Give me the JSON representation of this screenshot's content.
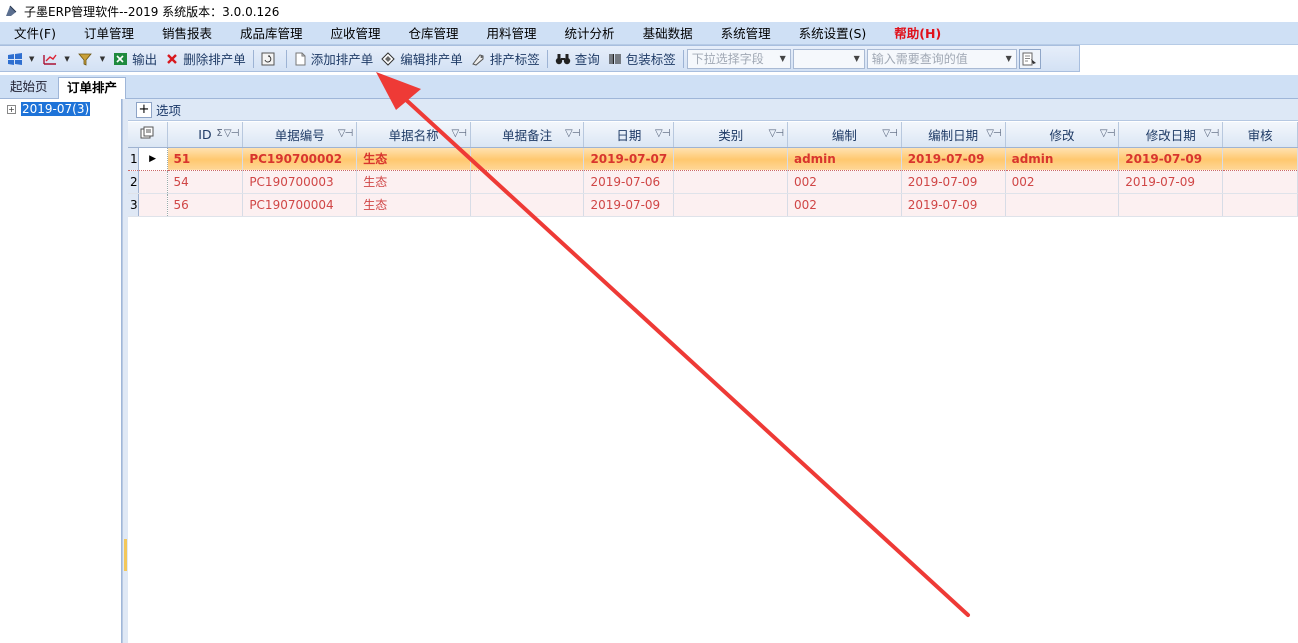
{
  "window": {
    "title": "子墨ERP管理软件--2019 系统版本：3.0.0.126"
  },
  "menu": [
    {
      "label": "文件(F)"
    },
    {
      "label": "订单管理"
    },
    {
      "label": "销售报表"
    },
    {
      "label": "成品库管理"
    },
    {
      "label": "应收管理"
    },
    {
      "label": "仓库管理"
    },
    {
      "label": "用料管理"
    },
    {
      "label": "统计分析"
    },
    {
      "label": "基础数据"
    },
    {
      "label": "系统管理"
    },
    {
      "label": "系统设置(S)"
    },
    {
      "label": "帮助(H)"
    }
  ],
  "toolbar": {
    "export": "输出",
    "delete": "删除排产单",
    "add": "添加排产单",
    "edit": "编辑排产单",
    "label": "排产标签",
    "query": "查询",
    "pack_label": "包装标签",
    "field_placeholder": "下拉选择字段",
    "value_placeholder": "输入需要查询的值"
  },
  "tabs": [
    {
      "label": "起始页"
    },
    {
      "label": "订单排产"
    }
  ],
  "tree": {
    "node": "2019-07(3)"
  },
  "grid": {
    "options_label": "选项",
    "columns": [
      "ID",
      "单据编号",
      "单据名称",
      "单据备注",
      "日期",
      "类别",
      "编制",
      "编制日期",
      "修改",
      "修改日期",
      "审核"
    ],
    "rows": [
      {
        "no": "1",
        "id": "51",
        "code": "PC190700002",
        "name": "生态",
        "note": "",
        "date": "2019-07-07",
        "type": "",
        "creator": "admin",
        "create_date": "2019-07-09",
        "modifier": "admin",
        "modify_date": "2019-07-09",
        "audit": ""
      },
      {
        "no": "2",
        "id": "54",
        "code": "PC190700003",
        "name": "生态",
        "note": "",
        "date": "2019-07-06",
        "type": "",
        "creator": "002",
        "create_date": "2019-07-09",
        "modifier": "002",
        "modify_date": "2019-07-09",
        "audit": ""
      },
      {
        "no": "3",
        "id": "56",
        "code": "PC190700004",
        "name": "生态",
        "note": "",
        "date": "2019-07-09",
        "type": "",
        "creator": "002",
        "create_date": "2019-07-09",
        "modifier": "",
        "modify_date": "",
        "audit": ""
      }
    ]
  },
  "colors": {
    "menu_bg": "#cfe0f5",
    "help_red": "#e0101a",
    "row_text": "#d04646",
    "selected_row": "#ffc86f",
    "arrow": "#ee3a36"
  }
}
